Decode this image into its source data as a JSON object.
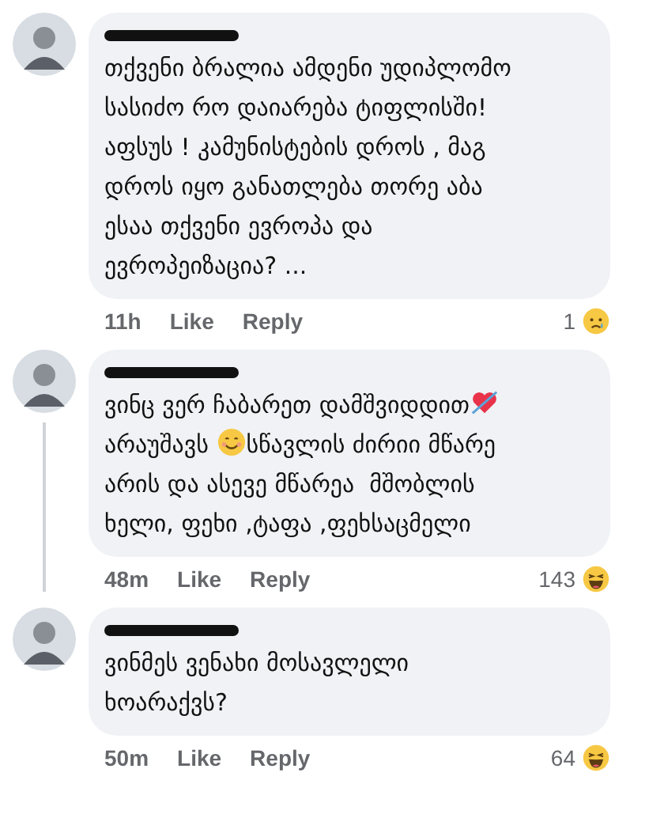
{
  "comments": [
    {
      "thread_line": false,
      "segments": [
        {
          "kind": "paragraph",
          "text": "თქვენი ბრალია ამდენი უდიპლომო\nსასიძო რო დაიარება ტიფლისში!\nაფსუს ! კამუნისტების დროს , მაგ\nდროს იყო განათლება თორე აბა\nესაა თქვენი ევროპა და\nევროპეიზაცია? ..."
        }
      ],
      "time": "11h",
      "like": "Like",
      "reply": "Reply",
      "reaction": {
        "count": "1",
        "kind": "sad"
      }
    },
    {
      "thread_line": true,
      "segments": [
        {
          "kind": "text",
          "text": "ვინც ვერ ჩაბარეთ დამშვიდდით"
        },
        {
          "kind": "heart"
        },
        {
          "kind": "break"
        },
        {
          "kind": "text",
          "text": "არაუშავს "
        },
        {
          "kind": "smile"
        },
        {
          "kind": "text",
          "text": "სწავლის ძირიი მწარე"
        },
        {
          "kind": "paragraph",
          "text": "არის და ასევე მწარეა  მშობლის\nხელი, ფეხი ,ტაფა ,ფეხსაცმელი"
        }
      ],
      "time": "48m",
      "like": "Like",
      "reply": "Reply",
      "reaction": {
        "count": "143",
        "kind": "haha"
      }
    },
    {
      "thread_line": false,
      "segments": [
        {
          "kind": "paragraph",
          "text": "ვინმეს ვენახი მოსავლელი\nხოარაქვს?"
        }
      ],
      "time": "50m",
      "like": "Like",
      "reply": "Reply",
      "reaction": {
        "count": "64",
        "kind": "haha"
      }
    }
  ]
}
